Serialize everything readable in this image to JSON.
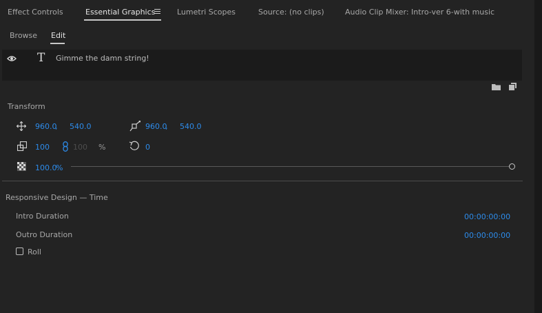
{
  "tabs": [
    {
      "label": "Effect Controls"
    },
    {
      "label": "Essential Graphics"
    },
    {
      "label": "Lumetri Scopes"
    },
    {
      "label": "Source: (no clips)"
    },
    {
      "label": "Audio Clip Mixer: Intro-ver 6-with music"
    }
  ],
  "subtabs": [
    {
      "label": "Browse"
    },
    {
      "label": "Edit"
    }
  ],
  "layer": {
    "name": "Gimme the damn string!"
  },
  "transform": {
    "title": "Transform",
    "position": {
      "x": "960.0",
      "sep": ",",
      "y": "540.0"
    },
    "anchor": {
      "x": "960.0",
      "sep": ",",
      "y": "540.0"
    },
    "scale": {
      "width": "100",
      "height": "100",
      "unit": "%"
    },
    "rotation": "0",
    "opacity": {
      "value": "100.0",
      "unit": "%",
      "level": 1.0
    }
  },
  "responsive": {
    "title": "Responsive Design — Time",
    "intro_label": "Intro Duration",
    "intro_value": "00:00:00:00",
    "outro_label": "Outro Duration",
    "outro_value": "00:00:00:00",
    "roll_label": "Roll",
    "roll_checked": false
  },
  "colors": {
    "accent": "#2d8ceb",
    "background": "#232323",
    "panel": "#1b1b1b"
  }
}
